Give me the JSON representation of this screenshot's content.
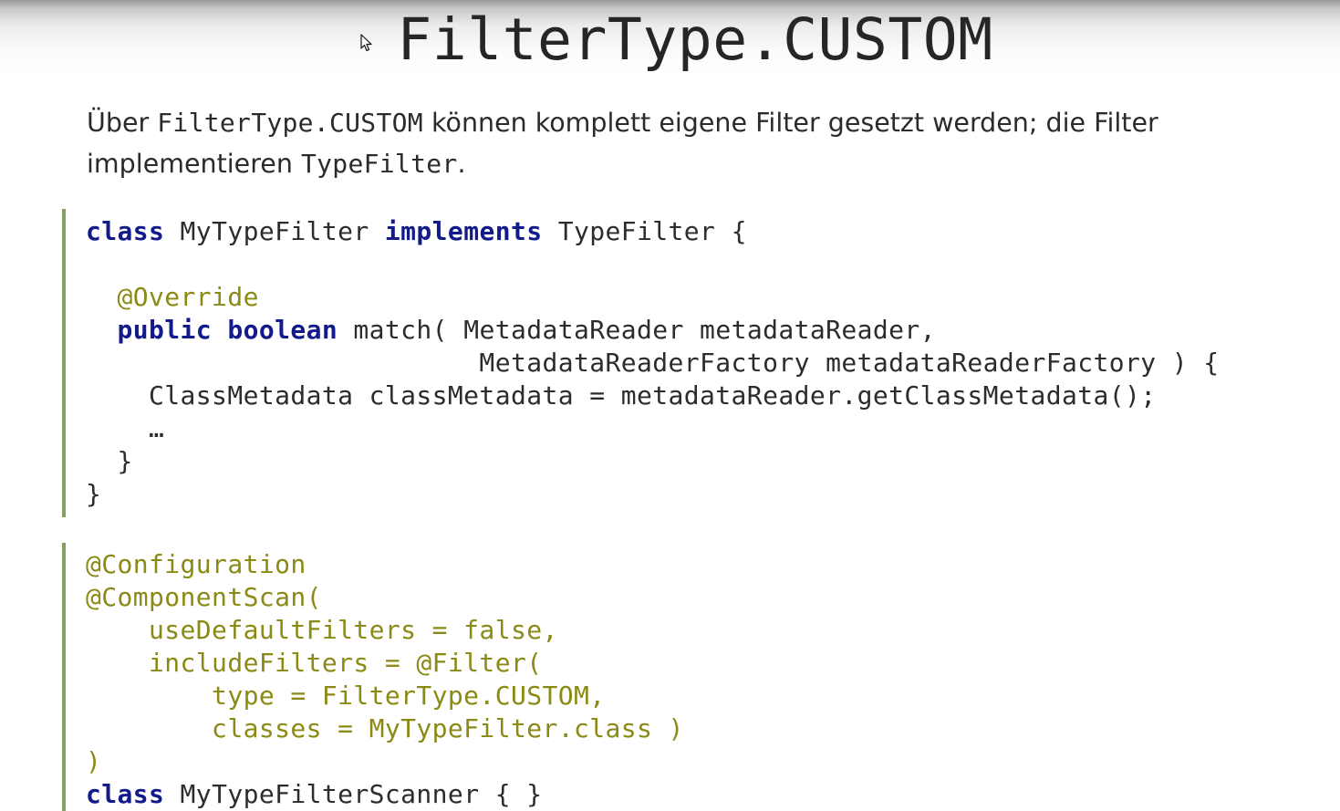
{
  "slide": {
    "title": "FilterType.CUSTOM",
    "intro": {
      "part1": "Über ",
      "code1": "FilterType.CUSTOM",
      "part2": " können komplett eigene Filter gesetzt werden; die Filter implementieren ",
      "code2": "TypeFilter",
      "part3": "."
    }
  },
  "code_block_1": {
    "l1_kw_class": "class",
    "l1_name": " MyTypeFilter ",
    "l1_kw_implements": "implements",
    "l1_rest": " TypeFilter {",
    "l3_indent": "  ",
    "l3_annotation": "@Override",
    "l4_indent": "  ",
    "l4_kw_public": "public",
    "l4_space": " ",
    "l4_kw_boolean": "boolean",
    "l4_rest": " match( MetadataReader metadataReader,",
    "l5": "                         MetadataReaderFactory metadataReaderFactory ) {",
    "l6": "    ClassMetadata classMetadata = metadataReader.getClassMetadata();",
    "l7": "    …",
    "l8": "  }",
    "l9": "}"
  },
  "code_block_2": {
    "l1": "@Configuration",
    "l2": "@ComponentScan(",
    "l3": "    useDefaultFilters = false,",
    "l4": "    includeFilters = @Filter(",
    "l5": "        type = FilterType.CUSTOM,",
    "l6": "        classes = MyTypeFilter.class )",
    "l7": ")",
    "l8_kw_class": "class",
    "l8_rest": " MyTypeFilterScanner { }"
  },
  "colors": {
    "keyword": "#131b8a",
    "annotation": "#8a8a14",
    "accent_bar": "#82a062",
    "text": "#2c2c2c"
  },
  "icons": {
    "cursor": "mouse-pointer-icon"
  }
}
